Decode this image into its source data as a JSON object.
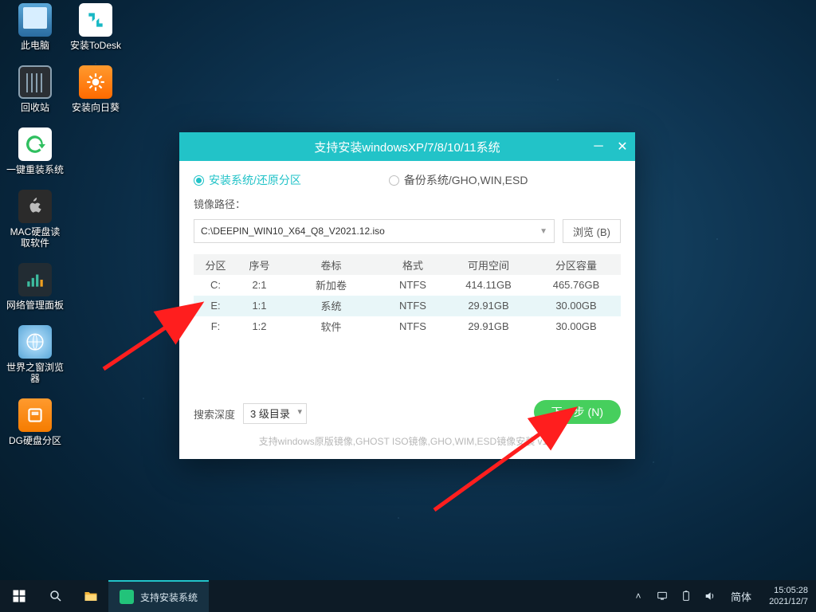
{
  "desktop_icons_left": [
    {
      "name": "此电脑",
      "icon": "pc"
    },
    {
      "name": "回收站",
      "icon": "bin"
    },
    {
      "name": "一键重装系统",
      "icon": "green"
    },
    {
      "name": "MAC硬盘读\n取软件",
      "icon": "black"
    },
    {
      "name": "网络管理面板",
      "icon": "dark"
    },
    {
      "name": "世界之窗浏览\n器",
      "icon": "globe"
    },
    {
      "name": "DG硬盘分区",
      "icon": "orange"
    }
  ],
  "desktop_icons_right": [
    {
      "name": "安装ToDesk",
      "icon": "todesk"
    },
    {
      "name": "安装向日葵",
      "icon": "sun"
    }
  ],
  "window": {
    "title": "支持安装windowsXP/7/8/10/11系统",
    "mode_install": "安装系统/还原分区",
    "mode_backup": "备份系统/GHO,WIN,ESD",
    "image_path_label": "镜像路径：",
    "image_path_value": "C:\\DEEPIN_WIN10_X64_Q8_V2021.12.iso",
    "browse": "浏览 (B)",
    "columns": {
      "part": "分区",
      "idx": "序号",
      "label": "卷标",
      "fmt": "格式",
      "free": "可用空间",
      "cap": "分区容量"
    },
    "rows": [
      {
        "part": "C:",
        "idx": "2:1",
        "label": "新加卷",
        "fmt": "NTFS",
        "free": "414.11GB",
        "cap": "465.76GB"
      },
      {
        "part": "E:",
        "idx": "1:1",
        "label": "系统",
        "fmt": "NTFS",
        "free": "29.91GB",
        "cap": "30.00GB"
      },
      {
        "part": "F:",
        "idx": "1:2",
        "label": "软件",
        "fmt": "NTFS",
        "free": "29.91GB",
        "cap": "30.00GB"
      }
    ],
    "depth_label": "搜索深度",
    "depth_value": "3 级目录",
    "next": "下一步 (N)",
    "support_text": "支持windows原版镜像,GHOST ISO镜像,GHO,WIM,ESD镜像安装   v1.0"
  },
  "taskbar": {
    "task_label": "支持安装系统",
    "ime": "简体",
    "time": "15:05:28",
    "date": "2021/12/7"
  }
}
